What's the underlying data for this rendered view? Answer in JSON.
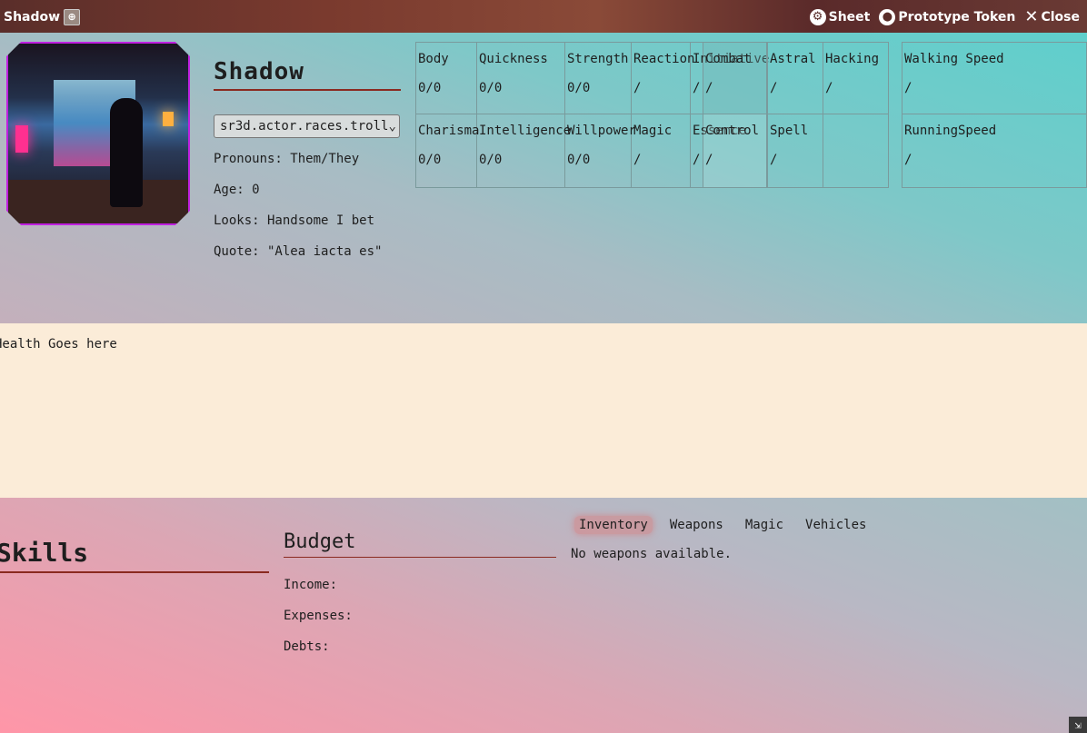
{
  "window": {
    "title": "Shadow",
    "buttons": {
      "sheet": "Sheet",
      "prototype_token": "Prototype Token",
      "close": "Close"
    }
  },
  "profile": {
    "name": "Shadow",
    "race": "sr3d.actor.races.troll",
    "pronouns": "Pronouns: Them/They",
    "age": "Age: 0",
    "looks": "Looks: Handsome I bet",
    "quote": "Quote: \"Alea iacta es\""
  },
  "attributes": {
    "row1": [
      {
        "label": "Body",
        "value": "0/0"
      },
      {
        "label": "Quickness",
        "value": "0/0"
      },
      {
        "label": "Strength",
        "value": "0/0"
      },
      {
        "label": "Reaction",
        "value": "/"
      },
      {
        "label": "Initiative",
        "value": "/"
      },
      {
        "label": "Combat",
        "value": "/"
      },
      {
        "label": "Astral",
        "value": "/"
      },
      {
        "label": "Hacking",
        "value": "/"
      }
    ],
    "row2": [
      {
        "label": "Charisma",
        "value": "0/0"
      },
      {
        "label": "Intelligence",
        "value": "0/0"
      },
      {
        "label": "Willpower",
        "value": "0/0"
      },
      {
        "label": "Magic",
        "value": "/"
      },
      {
        "label": "Essence",
        "value": "/"
      },
      {
        "label": "Control",
        "value": "/"
      },
      {
        "label": "Spell",
        "value": "/"
      }
    ],
    "speed": [
      {
        "label": "Walking Speed",
        "value": "/"
      },
      {
        "label": "RunningSpeed",
        "value": "/"
      }
    ]
  },
  "health": {
    "text": "Health Goes here"
  },
  "skills": {
    "title": "Skills"
  },
  "budget": {
    "title": "Budget",
    "income": "Income:",
    "expenses": "Expenses:",
    "debts": "Debts:"
  },
  "tabs": [
    "Inventory",
    "Weapons",
    "Magic",
    "Vehicles"
  ],
  "tab_content": "No weapons available."
}
